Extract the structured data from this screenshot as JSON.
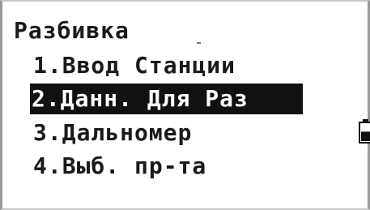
{
  "screen": {
    "title": "Разбивка"
  },
  "menu": {
    "items": [
      {
        "label": "1.Ввод Станции",
        "selected": false
      },
      {
        "label": "2.Данн. Для Раз",
        "selected": true
      },
      {
        "label": "3.Дальномер",
        "selected": false
      },
      {
        "label": "4.Выб. пр-та",
        "selected": false
      }
    ]
  },
  "status": {
    "battery_icon": "battery-icon",
    "battery_level": 0.55
  },
  "colors": {
    "background": "#ffffff",
    "text": "#1a1a1a",
    "highlight_bg": "#111111",
    "highlight_text": "#ffffff"
  }
}
